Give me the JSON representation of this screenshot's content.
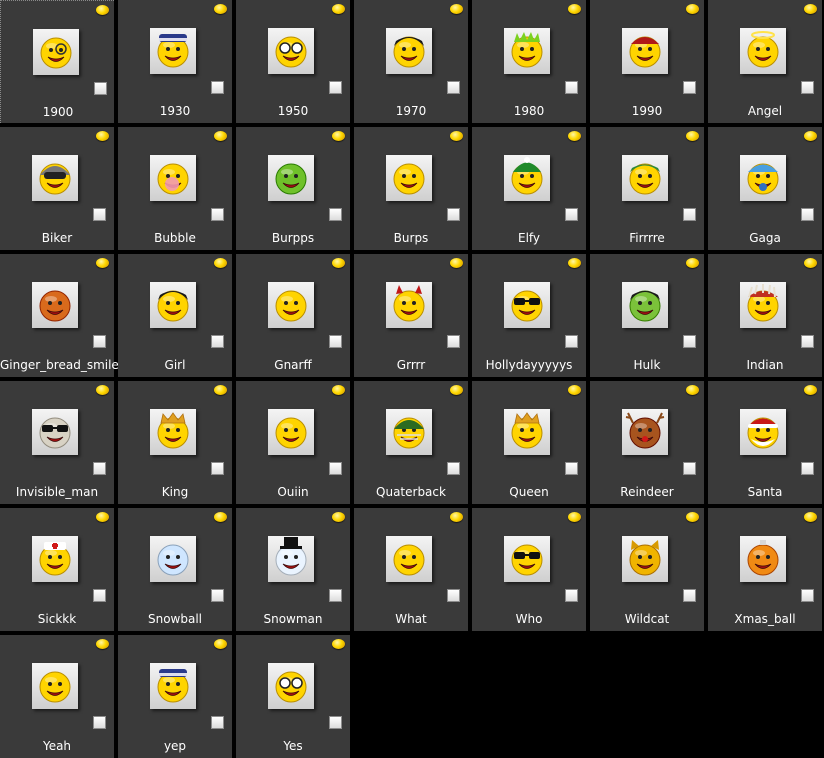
{
  "items": [
    {
      "label": "1900",
      "color": "#ffd400",
      "accessory": "monocle",
      "selected": true
    },
    {
      "label": "1930",
      "color": "#ffd400",
      "accessory": "hat"
    },
    {
      "label": "1950",
      "color": "#ffd400",
      "accessory": "glasses"
    },
    {
      "label": "1970",
      "color": "#ffd400",
      "accessory": "hair"
    },
    {
      "label": "1980",
      "color": "#ffd400",
      "accessory": "spiky"
    },
    {
      "label": "1990",
      "color": "#ffd400",
      "accessory": "cap"
    },
    {
      "label": "Angel",
      "color": "#ffd400",
      "accessory": "halo"
    },
    {
      "label": "Biker",
      "color": "#ffd400",
      "accessory": "helmet"
    },
    {
      "label": "Bubble",
      "color": "#ffd400",
      "accessory": "bubble"
    },
    {
      "label": "Burpps",
      "color": "#6fc12a",
      "accessory": "none"
    },
    {
      "label": "Burps",
      "color": "#ffd400",
      "accessory": "none"
    },
    {
      "label": "Elfy",
      "color": "#ffd400",
      "accessory": "elfhat"
    },
    {
      "label": "Firrrre",
      "color": "#ffd400",
      "accessory": "bandana"
    },
    {
      "label": "Gaga",
      "color": "#ffd400",
      "accessory": "bonnet"
    },
    {
      "label": "Ginger_bread_smiley",
      "color": "#d96a1c",
      "accessory": "none"
    },
    {
      "label": "Girl",
      "color": "#ffd400",
      "accessory": "hair"
    },
    {
      "label": "Gnarff",
      "color": "#ffd400",
      "accessory": "none"
    },
    {
      "label": "Grrrr",
      "color": "#ffd400",
      "accessory": "horns"
    },
    {
      "label": "Hollydayyyyys",
      "color": "#ffd400",
      "accessory": "sunglasses"
    },
    {
      "label": "Hulk",
      "color": "#7bc23a",
      "accessory": "hair"
    },
    {
      "label": "Indian",
      "color": "#ffd400",
      "accessory": "feathers"
    },
    {
      "label": "Invisible_man",
      "color": "#d8d2c4",
      "accessory": "sunglasses"
    },
    {
      "label": "King",
      "color": "#ffd400",
      "accessory": "crown"
    },
    {
      "label": "Ouiin",
      "color": "#ffd400",
      "accessory": "none"
    },
    {
      "label": "Quaterback",
      "color": "#ffd400",
      "accessory": "football"
    },
    {
      "label": "Queen",
      "color": "#ffd400",
      "accessory": "crown"
    },
    {
      "label": "Reindeer",
      "color": "#a8541e",
      "accessory": "antlers"
    },
    {
      "label": "Santa",
      "color": "#ffd400",
      "accessory": "santa"
    },
    {
      "label": "Sickkk",
      "color": "#ffd400",
      "accessory": "nurse"
    },
    {
      "label": "Snowball",
      "color": "#cfe6ff",
      "accessory": "none"
    },
    {
      "label": "Snowman",
      "color": "#eaf4ff",
      "accessory": "tophat"
    },
    {
      "label": "What",
      "color": "#ffd400",
      "accessory": "none"
    },
    {
      "label": "Who",
      "color": "#ffd400",
      "accessory": "sunglasses"
    },
    {
      "label": "Wildcat",
      "color": "#f0b400",
      "accessory": "ears"
    },
    {
      "label": "Xmas_ball",
      "color": "#f08a14",
      "accessory": "ornament"
    },
    {
      "label": "Yeah",
      "color": "#ffd400",
      "accessory": "none"
    },
    {
      "label": "yep",
      "color": "#ffd400",
      "accessory": "hat"
    },
    {
      "label": "Yes",
      "color": "#ffd400",
      "accessory": "glasses"
    }
  ]
}
